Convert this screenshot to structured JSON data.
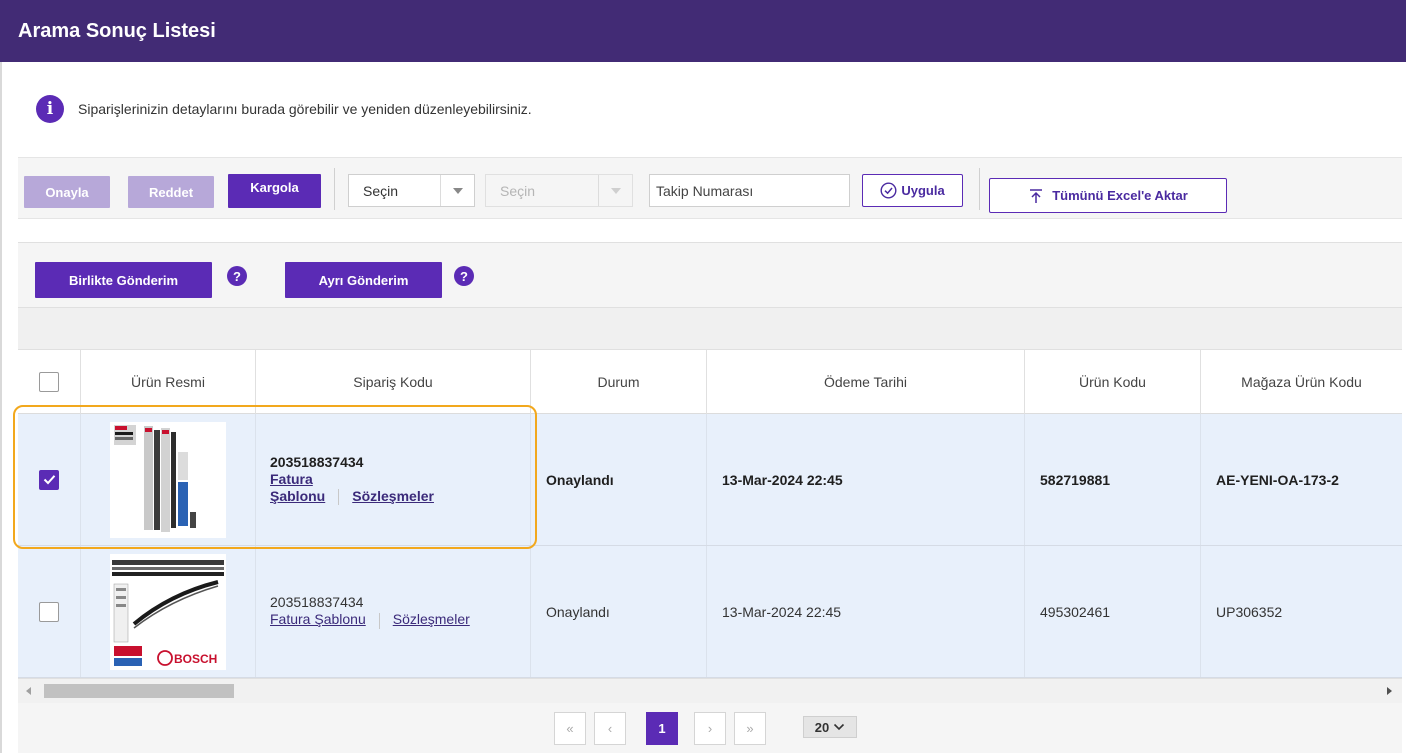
{
  "header": {
    "title": "Arama Sonuç Listesi"
  },
  "info": {
    "icon": "info-icon",
    "text": "Siparişlerinizin detaylarını burada görebilir ve yeniden düzenleyebilirsiniz."
  },
  "toolbar": {
    "approve_label": "Onayla",
    "reject_label": "Reddet",
    "ship_label": "Kargola",
    "select1_value": "Seçin",
    "select2_value": "Seçin",
    "tracking_placeholder": "Takip Numarası",
    "apply_label": "Uygula",
    "export_label": "Tümünü Excel'e Aktar"
  },
  "shipping": {
    "together_label": "Birlikte Gönderim",
    "separate_label": "Ayrı Gönderim",
    "help_glyph": "?"
  },
  "table": {
    "columns": [
      "Ürün Resmi",
      "Sipariş Kodu",
      "Durum",
      "Ödeme Tarihi",
      "Ürün Kodu",
      "Mağaza Ürün Kodu"
    ],
    "rows": [
      {
        "checked": true,
        "order_code": "203518837434",
        "invoice_link_line1": "Fatura",
        "invoice_link_line2": "Şablonu",
        "contracts_link": "Sözleşmeler",
        "status": "Onaylandı",
        "payment_date": "13-Mar-2024 22:45",
        "product_code": "582719881",
        "store_product_code": "AE-YENI-OA-173-2"
      },
      {
        "checked": false,
        "order_code": "203518837434",
        "invoice_link": "Fatura Şablonu",
        "contracts_link": "Sözleşmeler",
        "status": "Onaylandı",
        "payment_date": "13-Mar-2024 22:45",
        "product_code": "495302461",
        "store_product_code": "UP306352"
      }
    ]
  },
  "pagination": {
    "first": "«",
    "prev": "‹",
    "current_page": "1",
    "next": "›",
    "last": "»",
    "page_size": "20"
  },
  "colors": {
    "brand": "#422b75",
    "primary": "#5b2bb5",
    "highlight": "#f2a81d",
    "row_bg": "#e8f0fb"
  }
}
